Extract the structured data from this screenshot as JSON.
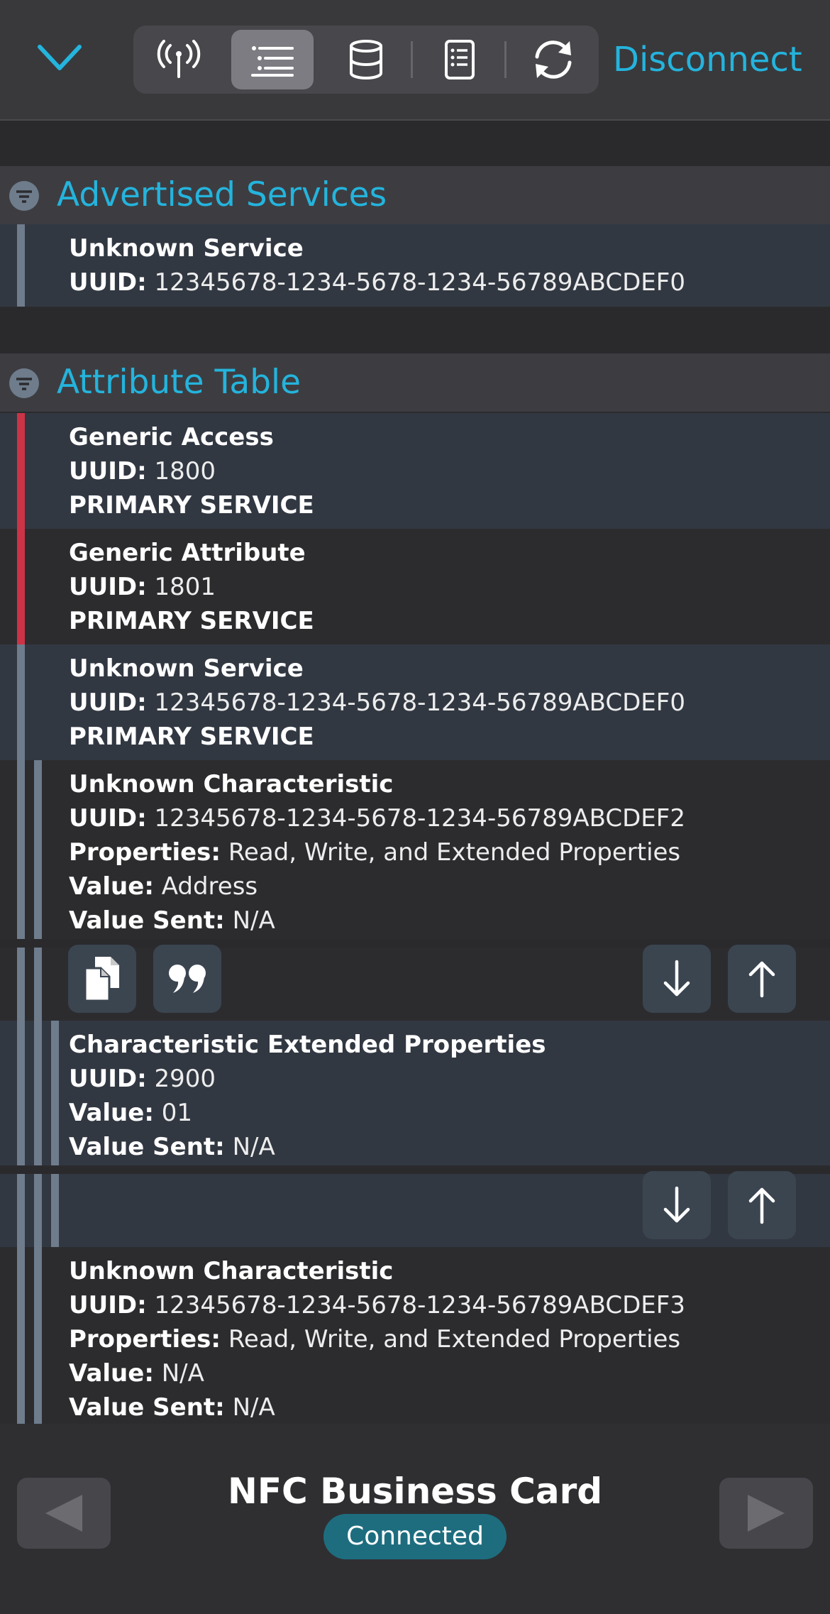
{
  "toolbar": {
    "collapse_icon": "chevron-down-icon",
    "segments": [
      {
        "icon": "antenna-icon",
        "active": false
      },
      {
        "icon": "list-icon",
        "active": true
      },
      {
        "icon": "database-icon",
        "active": false
      },
      {
        "icon": "document-icon",
        "active": false
      },
      {
        "icon": "refresh-icon",
        "active": false
      }
    ],
    "disconnect_label": "Disconnect",
    "accent_color": "#24b4dd"
  },
  "advertised": {
    "title": "Advertised Services",
    "items": [
      {
        "name": "Unknown Service",
        "uuid_label": "UUID:",
        "uuid": "12345678-1234-5678-1234-56789ABCDEF0"
      }
    ]
  },
  "attributes": {
    "title": "Attribute Table",
    "services": [
      {
        "name": "Generic Access",
        "uuid_label": "UUID:",
        "uuid": "1800",
        "kind": "PRIMARY SERVICE"
      },
      {
        "name": "Generic Attribute",
        "uuid_label": "UUID:",
        "uuid": "1801",
        "kind": "PRIMARY SERVICE"
      },
      {
        "name": "Unknown Service",
        "uuid_label": "UUID:",
        "uuid": "12345678-1234-5678-1234-56789ABCDEF0",
        "kind": "PRIMARY SERVICE"
      }
    ],
    "characteristic1": {
      "name": "Unknown Characteristic",
      "uuid_label": "UUID:",
      "uuid": "12345678-1234-5678-1234-56789ABCDEF2",
      "properties_label": "Properties:",
      "properties": "Read, Write, and Extended Properties",
      "value_label": "Value:",
      "value": "Address",
      "value_sent_label": "Value Sent:",
      "value_sent": "N/A"
    },
    "descriptor": {
      "name": "Characteristic Extended Properties",
      "uuid_label": "UUID:",
      "uuid": "2900",
      "value_label": "Value:",
      "value": "01",
      "value_sent_label": "Value Sent:",
      "value_sent": "N/A"
    },
    "characteristic2": {
      "name": "Unknown Characteristic",
      "uuid_label": "UUID:",
      "uuid": "12345678-1234-5678-1234-56789ABCDEF3",
      "properties_label": "Properties:",
      "properties": "Read, Write, and Extended Properties",
      "value_label": "Value:",
      "value": "N/A",
      "value_sent_label": "Value Sent:",
      "value_sent": "N/A"
    }
  },
  "bottom": {
    "device_name": "NFC Business Card",
    "status": "Connected",
    "status_color": "#1e6d7f"
  }
}
